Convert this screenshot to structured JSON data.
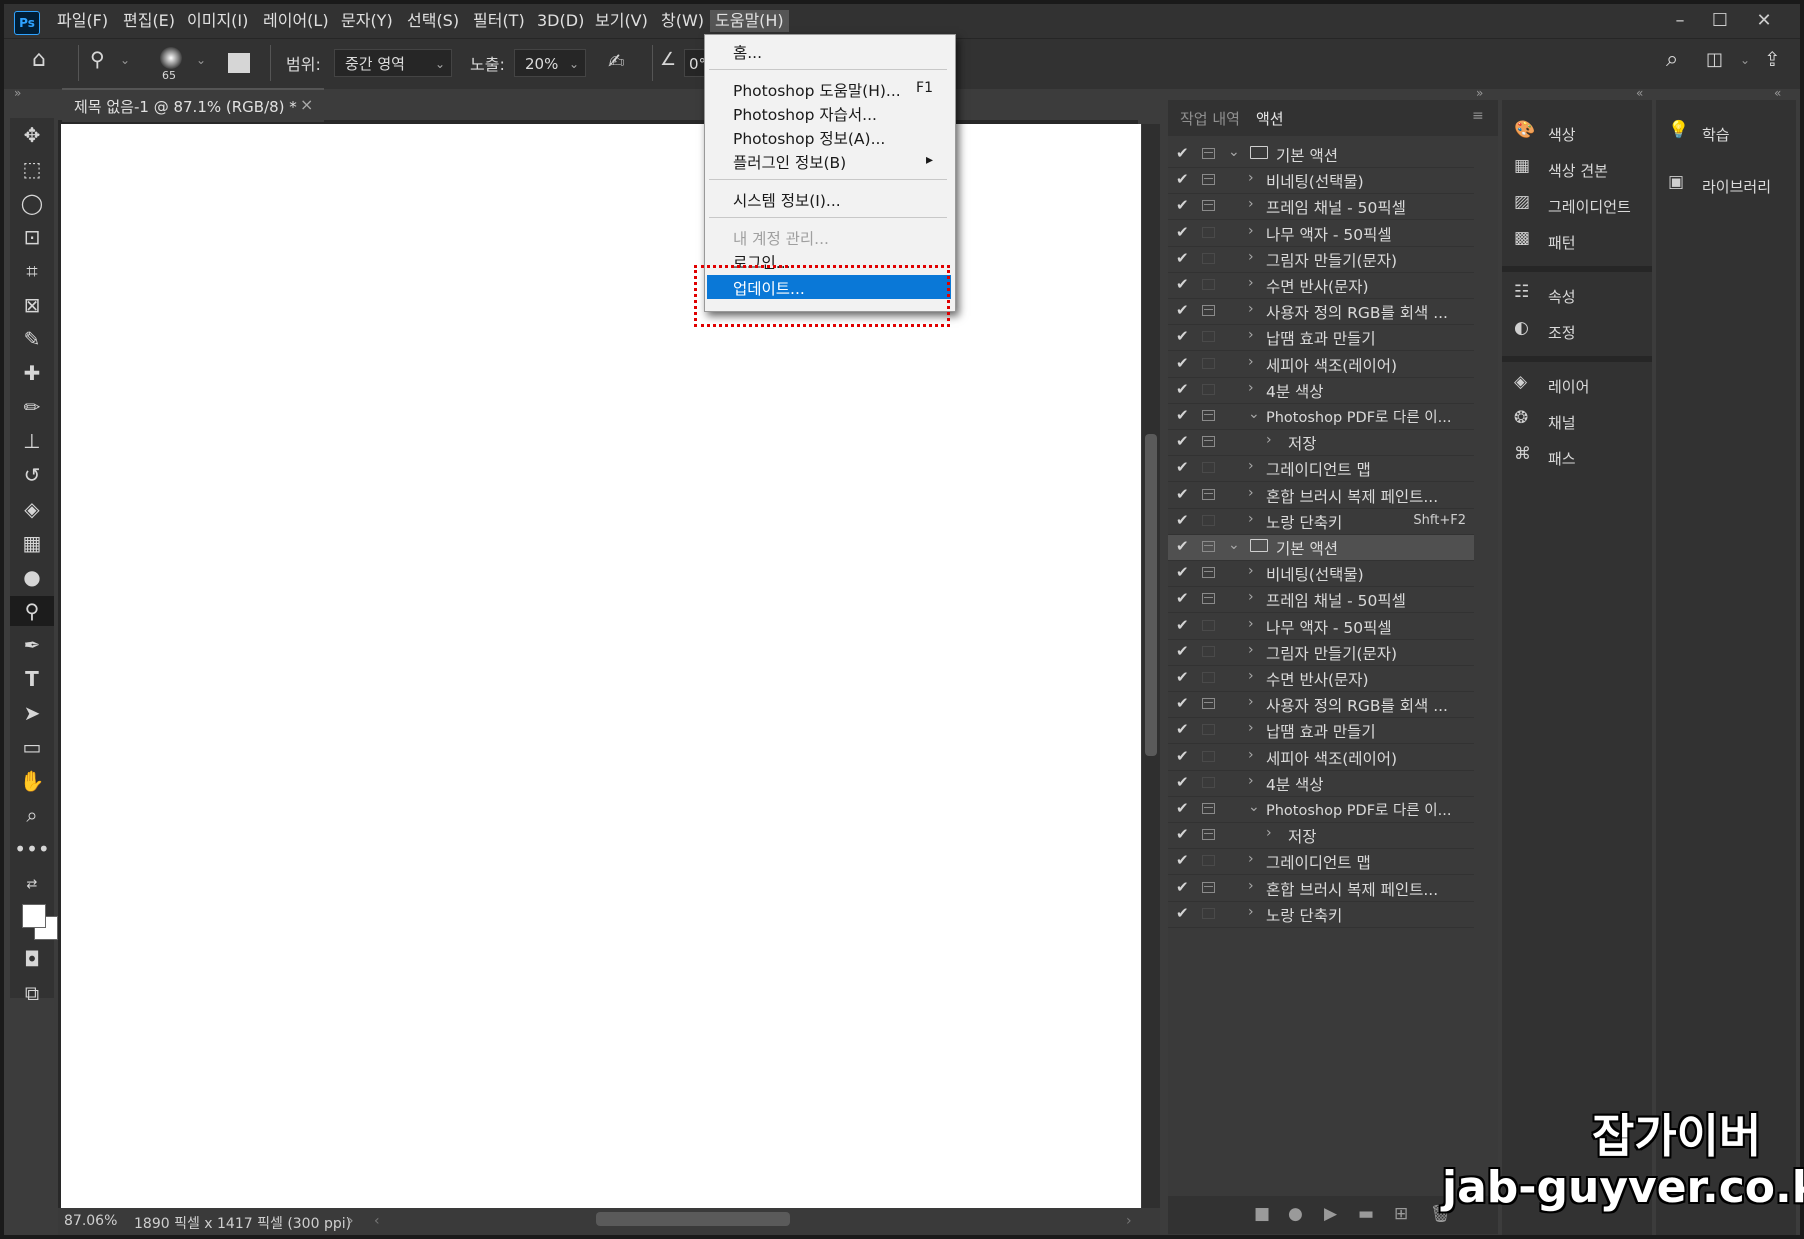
{
  "menubar": {
    "logo": "Ps",
    "items": [
      "파일(F)",
      "편집(E)",
      "이미지(I)",
      "레이어(L)",
      "문자(Y)",
      "선택(S)",
      "필터(T)",
      "3D(D)",
      "보기(V)",
      "창(W)",
      "도움말(H)"
    ],
    "active_index": 10,
    "window_controls": [
      "minimize-icon",
      "maximize-icon",
      "close-icon"
    ]
  },
  "options": {
    "brush_size": "65",
    "range_label": "범위:",
    "range_value": "중간 영역",
    "exposure_label": "노출:",
    "exposure_value": "20%",
    "angle_value": "0°"
  },
  "document": {
    "tab_title": "제목 없음-1 @ 87.1% (RGB/8) *",
    "zoom": "87.06%",
    "dimensions": "1890 픽셀 x 1417 픽셀 (300 ppi)"
  },
  "help_menu": {
    "items": [
      {
        "label": "홈...",
        "shortcut": "",
        "disabled": false
      },
      {
        "label": "Photoshop 도움말(H)...",
        "shortcut": "F1",
        "disabled": false
      },
      {
        "label": "Photoshop 자습서...",
        "shortcut": "",
        "disabled": false
      },
      {
        "label": "Photoshop 정보(A)...",
        "shortcut": "",
        "disabled": false
      },
      {
        "label": "플러그인 정보(B)",
        "shortcut": "",
        "disabled": false,
        "submenu": true
      },
      {
        "label": "시스템 정보(I)...",
        "shortcut": "",
        "disabled": false
      },
      {
        "label": "내 계정 관리...",
        "shortcut": "",
        "disabled": true
      },
      {
        "label": "로그인...",
        "shortcut": "",
        "disabled": false
      },
      {
        "label": "업데이트...",
        "shortcut": "",
        "disabled": false,
        "selected": true
      }
    ]
  },
  "actions_panel": {
    "tabs": [
      "작업 내역",
      "액션"
    ],
    "active_tab": 1,
    "rows": [
      {
        "label": "기본 액션",
        "level": 0,
        "folder": true,
        "expanded": true,
        "dialog": true
      },
      {
        "label": "비네팅(선택물)",
        "level": 1,
        "dialog": true
      },
      {
        "label": "프레임 채널 - 50픽셀",
        "level": 1,
        "dialog": true
      },
      {
        "label": "나무 액자 - 50픽셀",
        "level": 1,
        "dialog": false
      },
      {
        "label": "그림자 만들기(문자)",
        "level": 1,
        "dialog": false
      },
      {
        "label": "수면 반사(문자)",
        "level": 1,
        "dialog": false
      },
      {
        "label": "사용자 정의 RGB를 회색 ...",
        "level": 1,
        "dialog": true
      },
      {
        "label": "납땜 효과 만들기",
        "level": 1,
        "dialog": false
      },
      {
        "label": "세피아 색조(레이어)",
        "level": 1,
        "dialog": false
      },
      {
        "label": "4분 색상",
        "level": 1,
        "dialog": false
      },
      {
        "label": "Photoshop PDF로 다른 이...",
        "level": 1,
        "expanded": true,
        "dialog": true
      },
      {
        "label": "저장",
        "level": 2,
        "dialog": true
      },
      {
        "label": "그레이디언트 맵",
        "level": 1,
        "dialog": false
      },
      {
        "label": "혼합 브러시 복제 페인트...",
        "level": 1,
        "dialog": true
      },
      {
        "label": "노랑 단축키",
        "level": 1,
        "dialog": false,
        "shortcut": "Shft+F2"
      },
      {
        "label": "기본 액션",
        "level": 0,
        "folder": true,
        "expanded": true,
        "dialog": true,
        "highlight": true
      },
      {
        "label": "비네팅(선택물)",
        "level": 1,
        "dialog": true
      },
      {
        "label": "프레임 채널 - 50픽셀",
        "level": 1,
        "dialog": true
      },
      {
        "label": "나무 액자 - 50픽셀",
        "level": 1,
        "dialog": false
      },
      {
        "label": "그림자 만들기(문자)",
        "level": 1,
        "dialog": false
      },
      {
        "label": "수면 반사(문자)",
        "level": 1,
        "dialog": false
      },
      {
        "label": "사용자 정의 RGB를 회색 ...",
        "level": 1,
        "dialog": true
      },
      {
        "label": "납땜 효과 만들기",
        "level": 1,
        "dialog": false
      },
      {
        "label": "세피아 색조(레이어)",
        "level": 1,
        "dialog": false
      },
      {
        "label": "4분 색상",
        "level": 1,
        "dialog": false
      },
      {
        "label": "Photoshop PDF로 다른 이...",
        "level": 1,
        "expanded": true,
        "dialog": true
      },
      {
        "label": "저장",
        "level": 2,
        "dialog": true
      },
      {
        "label": "그레이디언트 맵",
        "level": 1,
        "dialog": false
      },
      {
        "label": "혼합 브러시 복제 페인트...",
        "level": 1,
        "dialog": true
      },
      {
        "label": "노랑 단축키",
        "level": 1,
        "dialog": false
      }
    ]
  },
  "dock": {
    "groups": [
      [
        {
          "label": "색상",
          "icon": "color-palette-icon"
        },
        {
          "label": "색상 견본",
          "icon": "swatches-icon"
        },
        {
          "label": "그레이디언트",
          "icon": "gradient-icon"
        },
        {
          "label": "패턴",
          "icon": "pattern-icon"
        }
      ],
      [
        {
          "label": "속성",
          "icon": "properties-icon"
        },
        {
          "label": "조정",
          "icon": "adjustments-icon"
        }
      ],
      [
        {
          "label": "레이어",
          "icon": "layers-icon"
        },
        {
          "label": "채널",
          "icon": "channels-icon"
        },
        {
          "label": "패스",
          "icon": "paths-icon"
        }
      ]
    ],
    "secondary": [
      {
        "label": "학습",
        "icon": "learn-icon"
      },
      {
        "label": "라이브러리",
        "icon": "libraries-icon"
      }
    ]
  },
  "watermark": {
    "title": "잡가이버",
    "url": "jab-guyver.co.kr"
  }
}
